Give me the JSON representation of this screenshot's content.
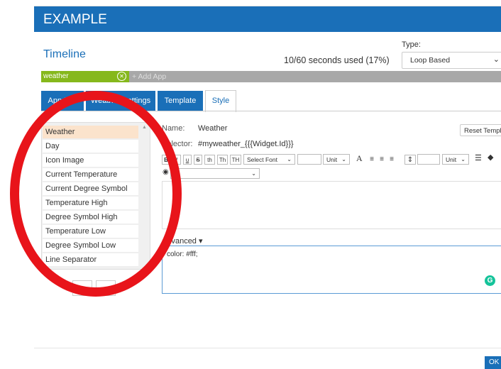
{
  "header": {
    "title": "EXAMPLE"
  },
  "timeline": {
    "title": "Timeline",
    "usage": "10/60 seconds used (17%)",
    "type_label": "Type:",
    "type_value": "Loop Based"
  },
  "appbar": {
    "app_name": "weather",
    "add_app": "+ Add App"
  },
  "tabs": [
    {
      "label": "App Info"
    },
    {
      "label": "Weather Settings"
    },
    {
      "label": "Template"
    },
    {
      "label": "Style"
    }
  ],
  "style_items": [
    "Weather",
    "Day",
    "Icon Image",
    "Current Temperature",
    "Current Degree Symbol",
    "Temperature High",
    "Degree Symbol High",
    "Temperature Low",
    "Degree Symbol Low",
    "Line Separator"
  ],
  "form": {
    "name_label": "Name:",
    "name_value": "Weather",
    "selector_label": "Selector:",
    "selector_value": "#myweather_{{{Widget.Id}}}",
    "reset_label": "Reset Template"
  },
  "toolbar": {
    "bold": "B",
    "italic": "I",
    "underline": "u",
    "strike": "S",
    "th1": "th",
    "th2": "Th",
    "th3": "TH",
    "font_select": "Select Font",
    "unit1": "Unit",
    "font_size_glyph": "A",
    "unit2": "Unit"
  },
  "advanced": {
    "label": "Advanced ▾",
    "code": "color: #fff;"
  },
  "footer": {
    "ok": "OK"
  },
  "colors": {
    "brand_blue": "#1a6fb8",
    "app_green": "#86b81c",
    "annotation_red": "#e8141a",
    "selected_row": "#fbe3cc"
  }
}
